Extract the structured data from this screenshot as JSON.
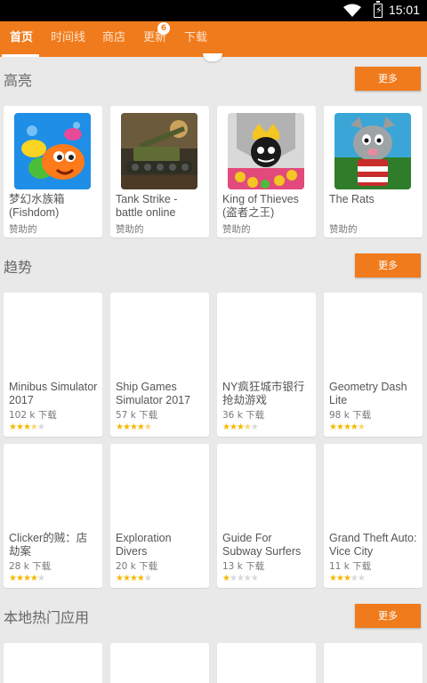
{
  "status": {
    "time": "15:01"
  },
  "tabs": [
    {
      "label": "首页",
      "active": true
    },
    {
      "label": "时间线",
      "active": false
    },
    {
      "label": "商店",
      "active": false
    },
    {
      "label": "更新",
      "active": false,
      "badge": "6"
    },
    {
      "label": "下载",
      "active": false
    }
  ],
  "sections": {
    "highlight": {
      "title": "高亮",
      "more": "更多",
      "items": [
        {
          "name": "梦幻水族箱 (Fishdom)",
          "sub": "赞助的",
          "icon": "fishdom-icon"
        },
        {
          "name": "Tank Strike - battle online",
          "sub": "赞助的",
          "icon": "tank-strike-icon"
        },
        {
          "name": "King of Thieves (盗者之王)",
          "sub": "赞助的",
          "icon": "king-of-thieves-icon"
        },
        {
          "name": "The Rats",
          "sub": "赞助的",
          "icon": "the-rats-icon"
        }
      ]
    },
    "trending": {
      "title": "趋势",
      "more": "更多",
      "items": [
        {
          "name": "Minibus Simulator 2017",
          "downloads": "102 k 下载",
          "rating": 3.5
        },
        {
          "name": "Ship Games Simulator 2017",
          "downloads": "57 k 下载",
          "rating": 4.5
        },
        {
          "name": "NY疯狂城市银行抢劫游戏",
          "downloads": "36 k 下载",
          "rating": 3.5
        },
        {
          "name": "Geometry Dash Lite",
          "downloads": "98 k 下载",
          "rating": 4.5
        },
        {
          "name": "Clicker的贼：店劫案",
          "downloads": "28 k 下载",
          "rating": 4
        },
        {
          "name": "Exploration Divers",
          "downloads": "20 k 下载",
          "rating": 4
        },
        {
          "name": "Guide For Subway Surfers",
          "downloads": "13 k 下载",
          "rating": 1
        },
        {
          "name": "Grand Theft Auto: Vice City",
          "downloads": "11 k 下载",
          "rating": 3
        }
      ]
    },
    "local": {
      "title": "本地热门应用",
      "more": "更多"
    }
  },
  "colors": {
    "accent": "#f07b1c",
    "star": "#f5b800"
  }
}
